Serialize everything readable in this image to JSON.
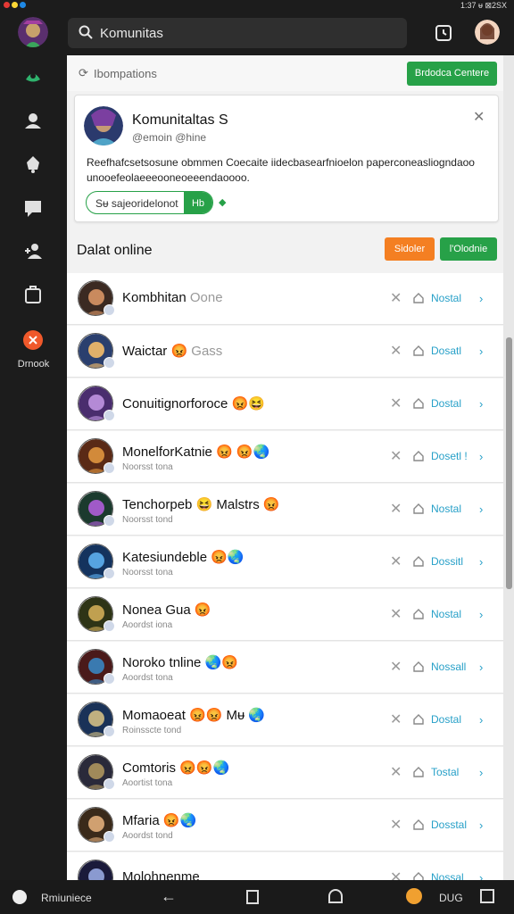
{
  "status_bar": {
    "right_text": "1:37 ᵾ ⊠2SX",
    "dot_colors": [
      "#e53935",
      "#fdd835",
      "#1e88e5"
    ]
  },
  "search": {
    "value": "Komunitas"
  },
  "sidebar": {
    "items": [
      {
        "icon": "game-icon"
      },
      {
        "icon": "user-icon"
      },
      {
        "icon": "bell-icon"
      },
      {
        "icon": "chat-icon"
      },
      {
        "icon": "add-user-icon"
      },
      {
        "icon": "box-icon"
      }
    ],
    "bottom_label": "Drnook"
  },
  "header": {
    "label": "Ibompations",
    "button_label": "Brdodca Centere"
  },
  "panel": {
    "title": "Komunitaltas S",
    "subtitle": "@emoin @hine",
    "description": "Reefhafcsetsosune obmmen Coecaite iidecbasearfnioelon paperconeasliogndaoo unooefeolaeeeooneoeeendaoooo.",
    "pill_label": "Sᵾ sajeoridelonot",
    "pill_button": "Hb"
  },
  "section": {
    "title": "Dalat online",
    "orange_button": "Sidoler",
    "green_button": "l'Olodnie"
  },
  "rows": [
    {
      "name": "Kombhitan",
      "status": "Oone",
      "sub": "",
      "action": "Nostal"
    },
    {
      "name": "Waictar 😡",
      "status": "Gass",
      "sub": "",
      "action": "Dosatl"
    },
    {
      "name": "Conuitignorforoce 😡😆",
      "status": "",
      "sub": "",
      "action": "Dostal"
    },
    {
      "name": "MonelforKatnie 😡 😡🌏",
      "status": "",
      "sub": "Noorsst tona",
      "action": "Dosetl !"
    },
    {
      "name": "Tenchorpeb 😆 Malstrs 😡",
      "status": "",
      "sub": "Noorsst tond",
      "action": "Nostal"
    },
    {
      "name": "Katesiundeble 😡🌏",
      "status": "",
      "sub": "Noorsst tona",
      "action": "Dossitl"
    },
    {
      "name": "Nonea Gua 😡",
      "status": "",
      "sub": "Aoordst iona",
      "action": "Nostal"
    },
    {
      "name": "Noroko tnline 🌏😡",
      "status": "",
      "sub": "Aoordst tona",
      "action": "Nossall"
    },
    {
      "name": "Momaoeat 😡😡 Mᵾ 🌏",
      "status": "",
      "sub": "Roinsscte tond",
      "action": "Dostal"
    },
    {
      "name": "Comtoris 😡😡🌏",
      "status": "",
      "sub": "Aoortist tona",
      "action": "Tostal"
    },
    {
      "name": "Mfaria 😡🌏",
      "status": "",
      "sub": "Aoordst tond",
      "action": "Dosstal"
    },
    {
      "name": "Molohnenme",
      "status": "",
      "sub": "",
      "action": "Nossal"
    }
  ],
  "navbar": {
    "label": "Rmiuniece",
    "right_label": "DUG"
  }
}
